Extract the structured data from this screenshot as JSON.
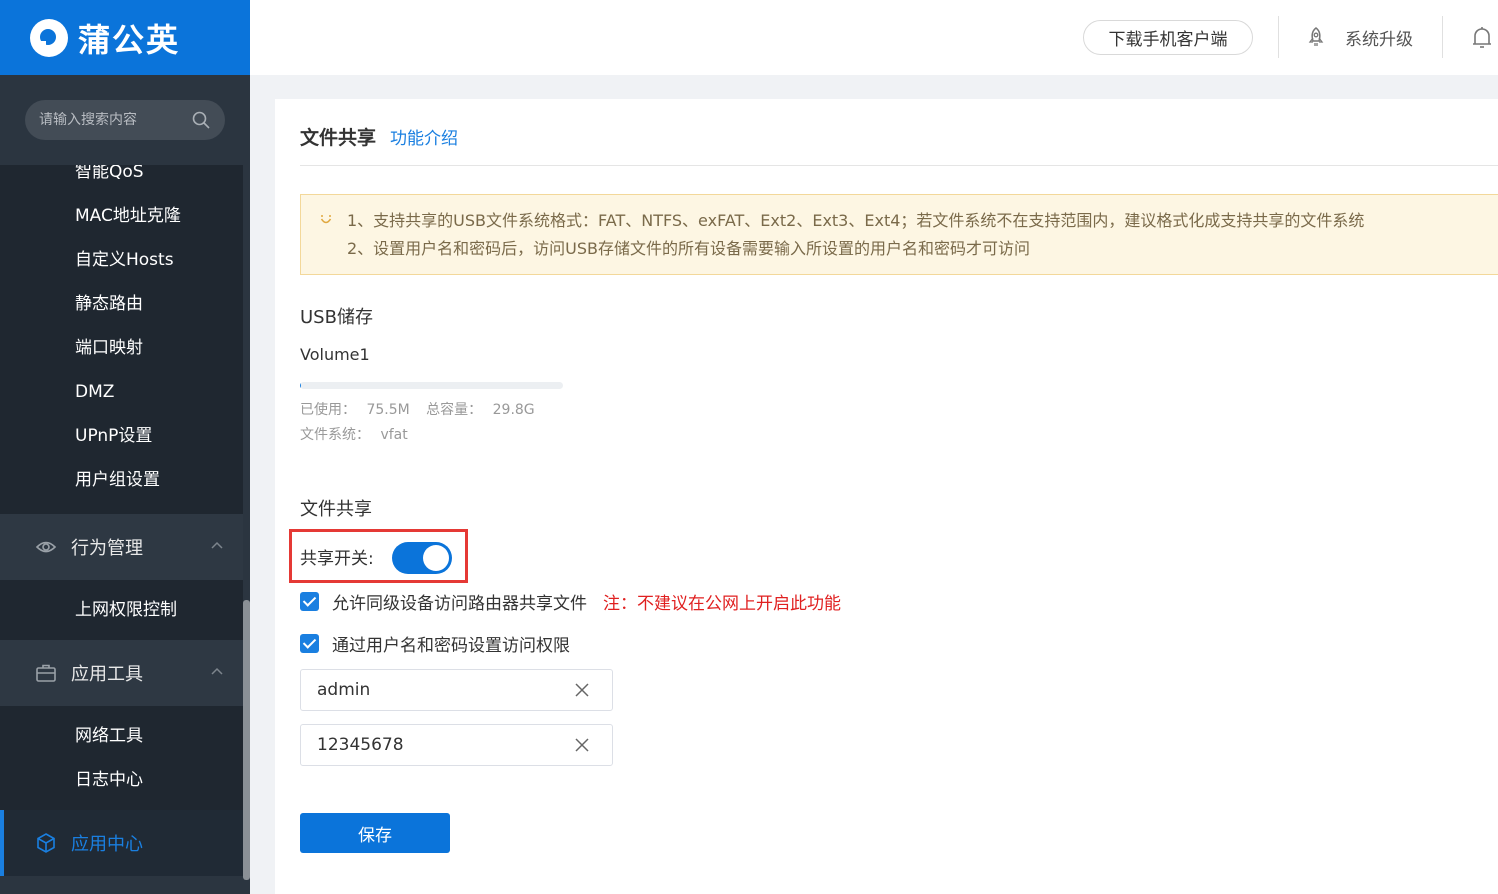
{
  "brand": {
    "name": "蒲公英"
  },
  "search": {
    "placeholder": "请输入搜索内容"
  },
  "header": {
    "download_label": "下载手机客户端",
    "upgrade_label": "系统升级"
  },
  "sidebar": {
    "partial_top_item": "智能QoS",
    "network_items": [
      "MAC地址克隆",
      "自定义Hosts",
      "静态路由",
      "端口映射",
      "DMZ",
      "UPnP设置",
      "用户组设置"
    ],
    "behavior_group": {
      "label": "行为管理",
      "items": [
        "上网权限控制"
      ]
    },
    "tools_group": {
      "label": "应用工具",
      "items": [
        "网络工具",
        "日志中心"
      ]
    },
    "active_item": {
      "label": "应用中心"
    }
  },
  "page": {
    "title": "文件共享",
    "intro_link": "功能介绍",
    "notice": [
      "1、支持共享的USB文件系统格式：FAT、NTFS、exFAT、Ext2、Ext3、Ext4；若文件系统不在支持范围内，建议格式化成支持共享的文件系统",
      "2、设置用户名和密码后，访问USB存储文件的所有设备需要输入所设置的用户名和密码才可访问"
    ],
    "usb": {
      "section_title": "USB储存",
      "volume_name": "Volume1",
      "used_label": "已使用：",
      "used_value": "75.5M",
      "total_label": "总容量：",
      "total_value": "29.8G",
      "usage_fraction": 0.0025,
      "fs_label": "文件系统：",
      "fs_value": "vfat"
    },
    "share": {
      "section_title": "文件共享",
      "switch_label": "共享开关:",
      "switch_on": true,
      "allow_peer_label": "允许同级设备访问路由器共享文件",
      "allow_peer_checked": true,
      "warning": "注：不建议在公网上开启此功能",
      "auth_label": "通过用户名和密码设置访问权限",
      "auth_checked": true,
      "username": "admin",
      "password": "12345678"
    },
    "save_label": "保存"
  },
  "colors": {
    "primary": "#0b74da",
    "sidebar_bg": "#2b3540",
    "warning_text": "#e02020",
    "notice_bg": "#fdf6e3"
  }
}
